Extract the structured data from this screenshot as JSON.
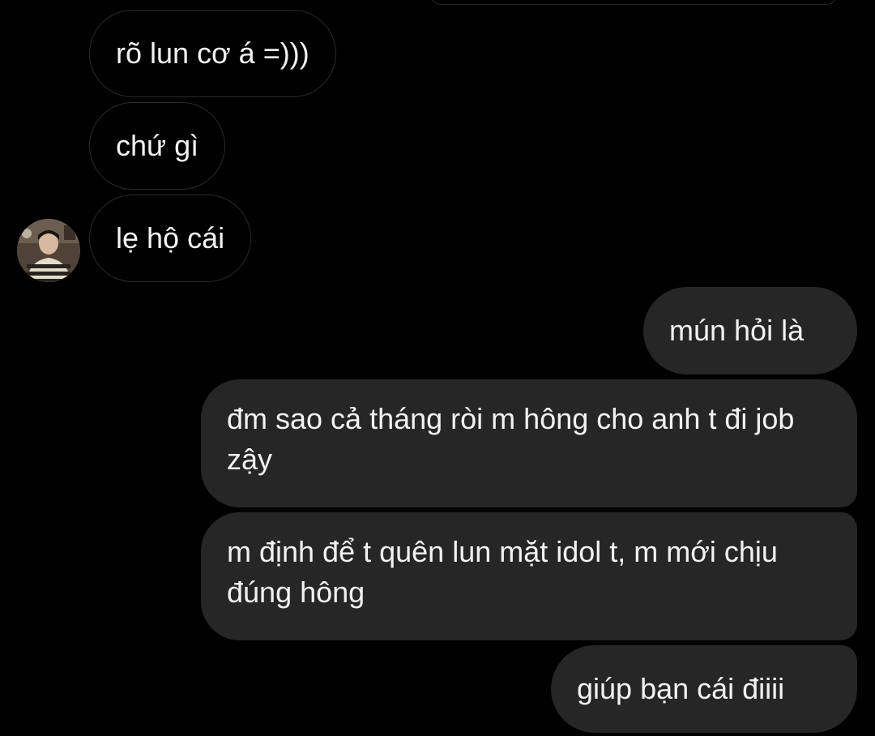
{
  "conversation": {
    "incoming": [
      {
        "text": "rõ lun cơ á =)))"
      },
      {
        "text": "chứ gì"
      },
      {
        "text": "lẹ hộ cái"
      }
    ],
    "outgoing": [
      {
        "text": "mún hỏi là"
      },
      {
        "text": "đm sao cả tháng ròi m hông cho anh t đi job zậy"
      },
      {
        "text": "m định để t quên lun mặt idol t, m mới chịu đúng hông"
      },
      {
        "text": "giúp bạn cái điiii"
      }
    ]
  },
  "sender": {
    "avatar_icon": "profile-photo-icon"
  },
  "colors": {
    "background": "#000000",
    "incoming_border": "#2b2b2b",
    "outgoing_bubble": "#262626",
    "text": "#f2f2f2"
  }
}
